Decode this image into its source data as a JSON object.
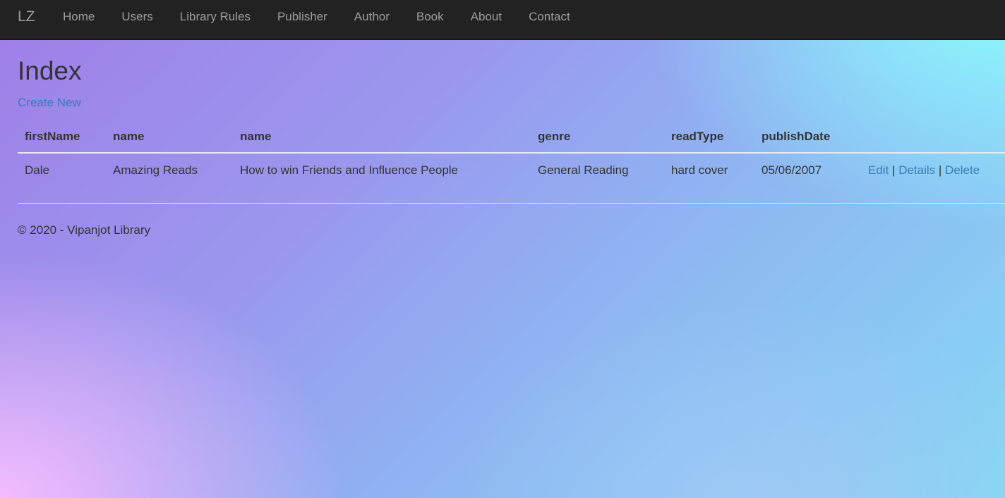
{
  "navbar": {
    "brand": "LZ",
    "items": [
      {
        "label": "Home"
      },
      {
        "label": "Users"
      },
      {
        "label": "Library Rules"
      },
      {
        "label": "Publisher"
      },
      {
        "label": "Author"
      },
      {
        "label": "Book"
      },
      {
        "label": "About"
      },
      {
        "label": "Contact"
      }
    ]
  },
  "main": {
    "title": "Index",
    "create_label": "Create New",
    "table": {
      "headers": [
        "firstName",
        "name",
        "name",
        "genre",
        "readType",
        "publishDate"
      ],
      "rows": [
        {
          "firstName": "Dale",
          "publisher": "Amazing Reads",
          "book": "How to win Friends and Influence People",
          "genre": "General Reading",
          "readType": "hard cover",
          "publishDate": "05/06/2007",
          "actions": {
            "edit": "Edit",
            "details": "Details",
            "delete": "Delete",
            "separator": "|"
          }
        }
      ]
    }
  },
  "footer": {
    "text": "© 2020 - Vipanjot Library"
  },
  "colors": {
    "navbar_bg": "#222222",
    "nav_text": "#9d9d9d",
    "link": "#3a7ab8",
    "text": "#333333"
  }
}
